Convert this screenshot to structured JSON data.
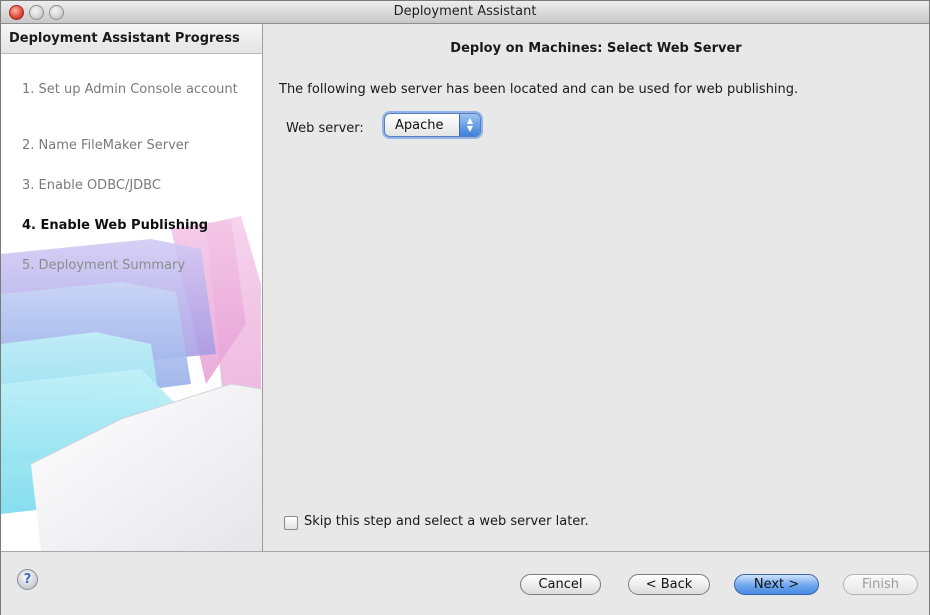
{
  "window": {
    "title": "Deployment Assistant"
  },
  "sidebar": {
    "header": "Deployment Assistant Progress",
    "steps": [
      {
        "label": "1. Set up Admin Console account",
        "state": "done"
      },
      {
        "label": "2. Name FileMaker Server",
        "state": "done"
      },
      {
        "label": "3. Enable ODBC/JDBC",
        "state": "done"
      },
      {
        "label": "4. Enable Web Publishing",
        "state": "active"
      },
      {
        "label": "5. Deployment Summary",
        "state": "upcoming"
      }
    ]
  },
  "main": {
    "title": "Deploy on Machines: Select Web Server",
    "description": "The following web server has been located and can be used for web publishing.",
    "web_server": {
      "label": "Web server:",
      "selected": "Apache"
    },
    "skip": {
      "label": "Skip this step and select a web server later.",
      "checked": false
    }
  },
  "footer": {
    "help_label": "?",
    "buttons": {
      "cancel": "Cancel",
      "back": "< Back",
      "next": "Next >",
      "finish": "Finish"
    }
  },
  "colors": {
    "primary_button": "#5a94e6",
    "accent_pink": "#e89ad2",
    "accent_cyan": "#8fe3f2",
    "accent_purple": "#a6a2e8"
  },
  "icons": {
    "help": "help-icon",
    "popup_arrows": "updown-arrows-icon"
  }
}
